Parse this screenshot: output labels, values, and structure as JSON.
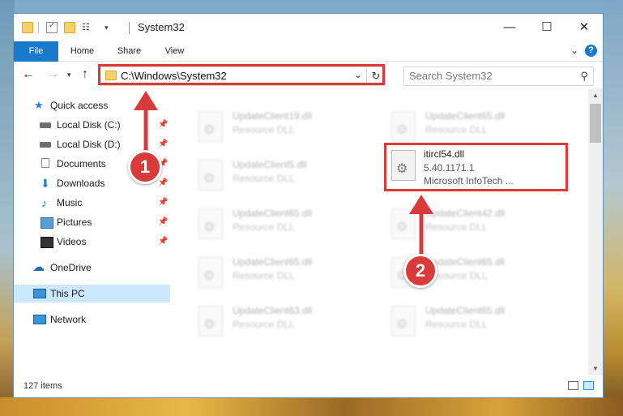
{
  "window": {
    "title": "System32",
    "controls": {
      "minimize": "—",
      "maximize": "☐",
      "close": "✕"
    }
  },
  "ribbon": {
    "tabs": [
      "File",
      "Home",
      "Share",
      "View"
    ],
    "help": "?"
  },
  "address": {
    "path": "C:\\Windows\\System32",
    "search_placeholder": "Search System32"
  },
  "nav": {
    "quick_access": "Quick access",
    "items": [
      {
        "label": "Local Disk (C:)",
        "pinned": true
      },
      {
        "label": "Local Disk (D:)",
        "pinned": true
      },
      {
        "label": "Documents",
        "pinned": true
      },
      {
        "label": "Downloads",
        "pinned": true
      },
      {
        "label": "Music",
        "pinned": true
      },
      {
        "label": "Pictures",
        "pinned": true
      },
      {
        "label": "Videos",
        "pinned": true
      }
    ],
    "onedrive": "OneDrive",
    "thispc": "This PC",
    "network": "Network"
  },
  "files": {
    "left": [
      {
        "name": "UpdateClient19.dll",
        "type": "Resource DLL"
      },
      {
        "name": "UpdateClient5.dll",
        "type": "Resource DLL"
      },
      {
        "name": "UpdateClient65.dll",
        "type": "Resource DLL"
      },
      {
        "name": "UpdateClient65.dll",
        "type": "Resource DLL"
      },
      {
        "name": "UpdateClient63.dll",
        "type": "Resource DLL"
      }
    ],
    "right": [
      {
        "name": "UpdateClient65.dll",
        "type": "Resource DLL"
      },
      {
        "name": "UpdateClient42.dll",
        "type": "Resource DLL"
      },
      {
        "name": "UpdateClient65.dll",
        "type": "Resource DLL"
      },
      {
        "name": "UpdateClient65.dll",
        "type": "Resource DLL"
      }
    ],
    "selected": {
      "name": "itircl54.dll",
      "version": "5.40.1171.1",
      "publisher": "Microsoft InfoTech ..."
    }
  },
  "status": {
    "count": "127 items"
  },
  "annotations": {
    "step1": "1",
    "step2": "2",
    "color": "#d93a3a"
  }
}
